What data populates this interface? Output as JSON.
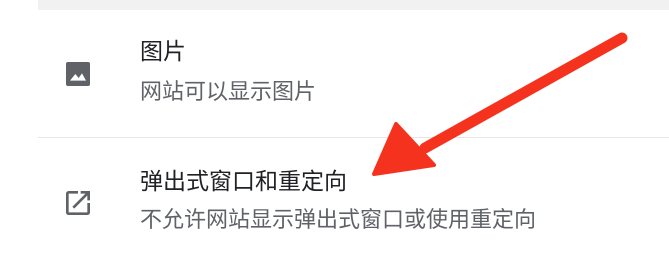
{
  "settings": {
    "images": {
      "icon": "image-icon",
      "title": "图片",
      "subtitle": "网站可以显示图片"
    },
    "popups": {
      "icon": "open-in-new-icon",
      "title": "弹出式窗口和重定向",
      "subtitle": "不允许网站显示弹出式窗口或使用重定向"
    }
  },
  "colors": {
    "title": "#202124",
    "subtitle": "#5f6368",
    "icon": "#5f6368",
    "arrow": "#f5321e"
  }
}
